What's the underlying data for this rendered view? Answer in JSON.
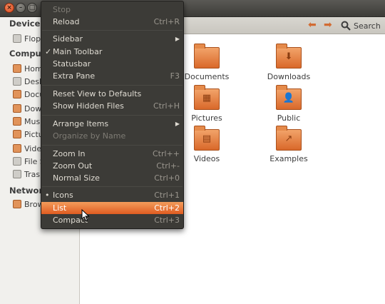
{
  "window": {
    "close": "×",
    "minimize": "–",
    "maximize": "□"
  },
  "toolbar": {
    "back_icon": "left-arrow-icon",
    "forward_icon": "right-arrow-icon",
    "search_label": "Search",
    "search_icon": "search-icon"
  },
  "sidebar": {
    "devices_heading": "Devices",
    "devices": [
      {
        "label": "Flop"
      }
    ],
    "computer_heading": "Comput",
    "computer": [
      {
        "label": "Hom"
      },
      {
        "label": "Desk"
      },
      {
        "label": "Docu"
      },
      {
        "label": "Dow"
      },
      {
        "label": "Musi"
      },
      {
        "label": "Pictu"
      },
      {
        "label": "Vide"
      },
      {
        "label": "File S"
      },
      {
        "label": "Trash"
      }
    ],
    "network_heading": "Network",
    "network": [
      {
        "label": "Brow"
      }
    ]
  },
  "files": [
    {
      "label": "Documents",
      "emblem": ""
    },
    {
      "label": "Downloads",
      "emblem": "⬇"
    },
    {
      "label": "Pictures",
      "emblem": "▦"
    },
    {
      "label": "Public",
      "emblem": "👤"
    },
    {
      "label": "Videos",
      "emblem": "▤"
    },
    {
      "label": "Examples",
      "emblem": "↗"
    }
  ],
  "menu": {
    "items": [
      {
        "label": "Stop",
        "accel": "",
        "disabled": true
      },
      {
        "label": "Reload",
        "accel": "Ctrl+R"
      },
      {
        "label": "Sidebar",
        "accel": "",
        "submenu": true
      },
      {
        "label": "Main Toolbar",
        "accel": "",
        "checked": true
      },
      {
        "label": "Statusbar",
        "accel": ""
      },
      {
        "label": "Extra Pane",
        "accel": "F3"
      },
      {
        "label": "Reset View to Defaults",
        "accel": ""
      },
      {
        "label": "Show Hidden Files",
        "accel": "Ctrl+H"
      },
      {
        "label": "Arrange Items",
        "accel": "",
        "submenu": true
      },
      {
        "label": "Organize by Name",
        "accel": "",
        "disabled": true
      },
      {
        "label": "Zoom In",
        "accel": "Ctrl++"
      },
      {
        "label": "Zoom Out",
        "accel": "Ctrl+-"
      },
      {
        "label": "Normal Size",
        "accel": "Ctrl+0"
      },
      {
        "label": "Icons",
        "accel": "Ctrl+1",
        "radio": true
      },
      {
        "label": "List",
        "accel": "Ctrl+2",
        "active": true
      },
      {
        "label": "Compact",
        "accel": "Ctrl+3"
      }
    ],
    "submenu_glyph": "▶",
    "check_glyph": "✓",
    "radio_glyph": "•"
  },
  "colors": {
    "accent": "#e05c21",
    "menu_bg": "#3c3b37",
    "folder": "#e07a3c"
  }
}
